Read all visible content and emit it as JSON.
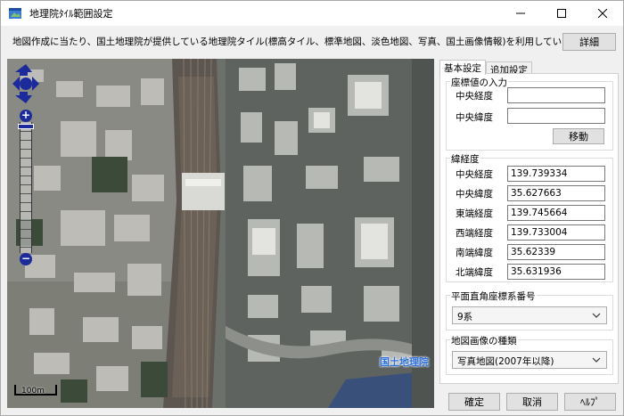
{
  "window": {
    "title": "地理院ﾀｲﾙ範囲設定"
  },
  "description": "地図作成に当たり、国土地理院が提供している地理院タイル(標高タイル、標準地図、淡色地図、写真、国土画像情報)を利用しています。",
  "buttons": {
    "detail": "詳細",
    "move": "移動",
    "ok": "確定",
    "cancel": "取消",
    "help": "ﾍﾙﾌﾟ"
  },
  "map": {
    "attribution": "国土地理院",
    "scale_label": "100m",
    "zoom_in": "+",
    "zoom_out": "−"
  },
  "tabs": [
    {
      "label": "基本設定",
      "active": true
    },
    {
      "label": "追加設定",
      "active": false
    }
  ],
  "coord_input": {
    "title": "座標値の入力",
    "center_lon_label": "中央経度",
    "center_lon_value": "",
    "center_lat_label": "中央緯度",
    "center_lat_value": ""
  },
  "latlon": {
    "title": "緯経度",
    "rows": [
      {
        "label": "中央経度",
        "value": "139.739334"
      },
      {
        "label": "中央緯度",
        "value": "35.627663"
      },
      {
        "label": "東端経度",
        "value": "139.745664"
      },
      {
        "label": "西端経度",
        "value": "139.733004"
      },
      {
        "label": "南端緯度",
        "value": "35.62339"
      },
      {
        "label": "北端緯度",
        "value": "35.631936"
      }
    ]
  },
  "plane_system": {
    "title": "平面直角座標系番号",
    "selected": "9系"
  },
  "map_type": {
    "title": "地図画像の種類",
    "selected": "写真地図(2007年以降)"
  },
  "colors": {
    "accent": "#1c2b9b",
    "attribution": "#2a6fdc"
  }
}
